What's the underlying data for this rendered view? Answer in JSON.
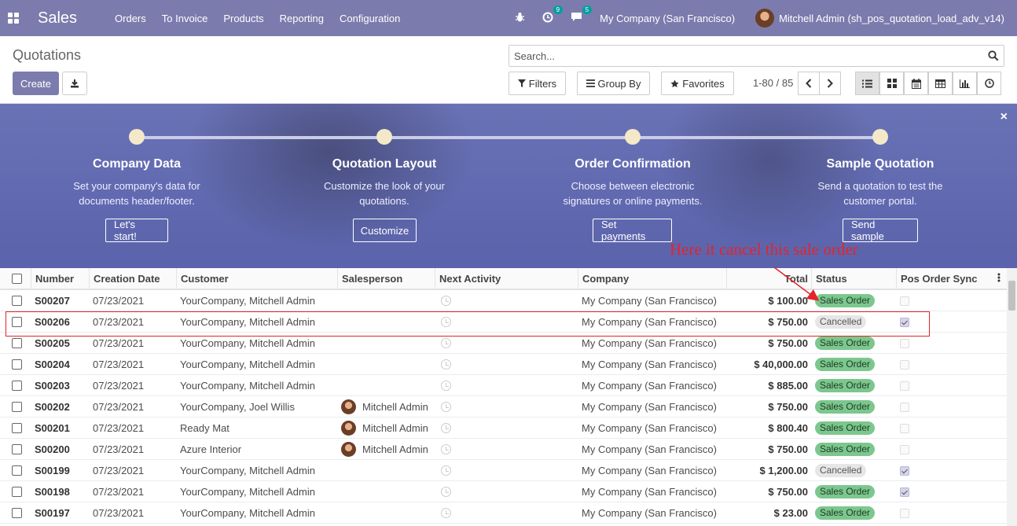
{
  "topnav": {
    "app_name": "Sales",
    "menu": [
      "Orders",
      "To Invoice",
      "Products",
      "Reporting",
      "Configuration"
    ],
    "activity_badge": "9",
    "messages_badge": "5",
    "company": "My Company (San Francisco)",
    "user": "Mitchell Admin (sh_pos_quotation_load_adv_v14)"
  },
  "control": {
    "title": "Quotations",
    "create_label": "Create",
    "search_placeholder": "Search...",
    "filters_label": "Filters",
    "groupby_label": "Group By",
    "favorites_label": "Favorites",
    "pager": "1-80 / 85"
  },
  "banner": {
    "steps": [
      {
        "title": "Company Data",
        "desc1": "Set your company's data for",
        "desc2": "documents header/footer.",
        "button": "Let's start!"
      },
      {
        "title": "Quotation Layout",
        "desc1": "Customize the look of your",
        "desc2": "quotations.",
        "button": "Customize"
      },
      {
        "title": "Order Confirmation",
        "desc1": "Choose between electronic",
        "desc2": "signatures or online payments.",
        "button": "Set payments"
      },
      {
        "title": "Sample Quotation",
        "desc1": "Send a quotation to test the",
        "desc2": "customer portal.",
        "button": "Send sample"
      }
    ],
    "close": "×"
  },
  "annotation": "Here it cancel this sale order",
  "table": {
    "headers": [
      "Number",
      "Creation Date",
      "Customer",
      "Salesperson",
      "Next Activity",
      "Company",
      "Total",
      "Status",
      "Pos Order Sync"
    ],
    "rows": [
      {
        "number": "S00207",
        "date": "07/23/2021",
        "customer": "YourCompany, Mitchell Admin",
        "salesperson": "",
        "company": "My Company (San Francisco)",
        "total": "$ 100.00",
        "status": "Sales Order",
        "synced": false
      },
      {
        "number": "S00206",
        "date": "07/23/2021",
        "customer": "YourCompany, Mitchell Admin",
        "salesperson": "",
        "company": "My Company (San Francisco)",
        "total": "$ 750.00",
        "status": "Cancelled",
        "synced": true
      },
      {
        "number": "S00205",
        "date": "07/23/2021",
        "customer": "YourCompany, Mitchell Admin",
        "salesperson": "",
        "company": "My Company (San Francisco)",
        "total": "$ 750.00",
        "status": "Sales Order",
        "synced": false
      },
      {
        "number": "S00204",
        "date": "07/23/2021",
        "customer": "YourCompany, Mitchell Admin",
        "salesperson": "",
        "company": "My Company (San Francisco)",
        "total": "$ 40,000.00",
        "status": "Sales Order",
        "synced": false
      },
      {
        "number": "S00203",
        "date": "07/23/2021",
        "customer": "YourCompany, Mitchell Admin",
        "salesperson": "",
        "company": "My Company (San Francisco)",
        "total": "$ 885.00",
        "status": "Sales Order",
        "synced": false
      },
      {
        "number": "S00202",
        "date": "07/23/2021",
        "customer": "YourCompany, Joel Willis",
        "salesperson": "Mitchell Admin",
        "company": "My Company (San Francisco)",
        "total": "$ 750.00",
        "status": "Sales Order",
        "synced": false
      },
      {
        "number": "S00201",
        "date": "07/23/2021",
        "customer": "Ready Mat",
        "salesperson": "Mitchell Admin",
        "company": "My Company (San Francisco)",
        "total": "$ 800.40",
        "status": "Sales Order",
        "synced": false
      },
      {
        "number": "S00200",
        "date": "07/23/2021",
        "customer": "Azure Interior",
        "salesperson": "Mitchell Admin",
        "company": "My Company (San Francisco)",
        "total": "$ 750.00",
        "status": "Sales Order",
        "synced": false
      },
      {
        "number": "S00199",
        "date": "07/23/2021",
        "customer": "YourCompany, Mitchell Admin",
        "salesperson": "",
        "company": "My Company (San Francisco)",
        "total": "$ 1,200.00",
        "status": "Cancelled",
        "synced": true
      },
      {
        "number": "S00198",
        "date": "07/23/2021",
        "customer": "YourCompany, Mitchell Admin",
        "salesperson": "",
        "company": "My Company (San Francisco)",
        "total": "$ 750.00",
        "status": "Sales Order",
        "synced": true
      },
      {
        "number": "S00197",
        "date": "07/23/2021",
        "customer": "YourCompany, Mitchell Admin",
        "salesperson": "",
        "company": "My Company (San Francisco)",
        "total": "$ 23.00",
        "status": "Sales Order",
        "synced": false
      }
    ]
  },
  "colors": {
    "brand": "#7c7bad",
    "sales_order": "#7cc78d",
    "annotation": "#e3242b"
  }
}
